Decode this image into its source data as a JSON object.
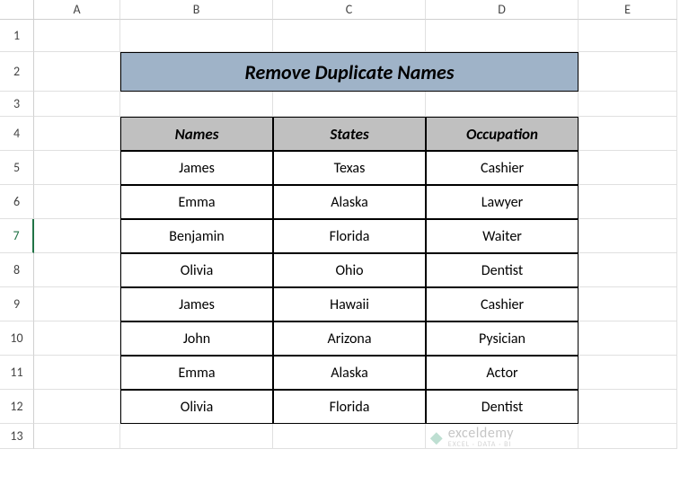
{
  "columns": [
    "A",
    "B",
    "C",
    "D",
    "E"
  ],
  "rows": [
    "1",
    "2",
    "3",
    "4",
    "5",
    "6",
    "7",
    "8",
    "9",
    "10",
    "11",
    "12",
    "13"
  ],
  "selected_row": "7",
  "title": "Remove Duplicate Names",
  "chart_data": {
    "type": "table",
    "title": "Remove Duplicate Names",
    "headers": [
      "Names",
      "States",
      "Occupation"
    ],
    "rows": [
      [
        "James",
        "Texas",
        "Cashier"
      ],
      [
        "Emma",
        "Alaska",
        "Lawyer"
      ],
      [
        "Benjamin",
        "Florida",
        "Waiter"
      ],
      [
        "Olivia",
        "Ohio",
        "Dentist"
      ],
      [
        "James",
        "Hawaii",
        "Cashier"
      ],
      [
        "John",
        "Arizona",
        "Pysician"
      ],
      [
        "Emma",
        "Alaska",
        "Actor"
      ],
      [
        "Olivia",
        "Florida",
        "Dentist"
      ]
    ]
  },
  "watermark": {
    "main": "exceldemy",
    "sub": "EXCEL · DATA · BI"
  }
}
